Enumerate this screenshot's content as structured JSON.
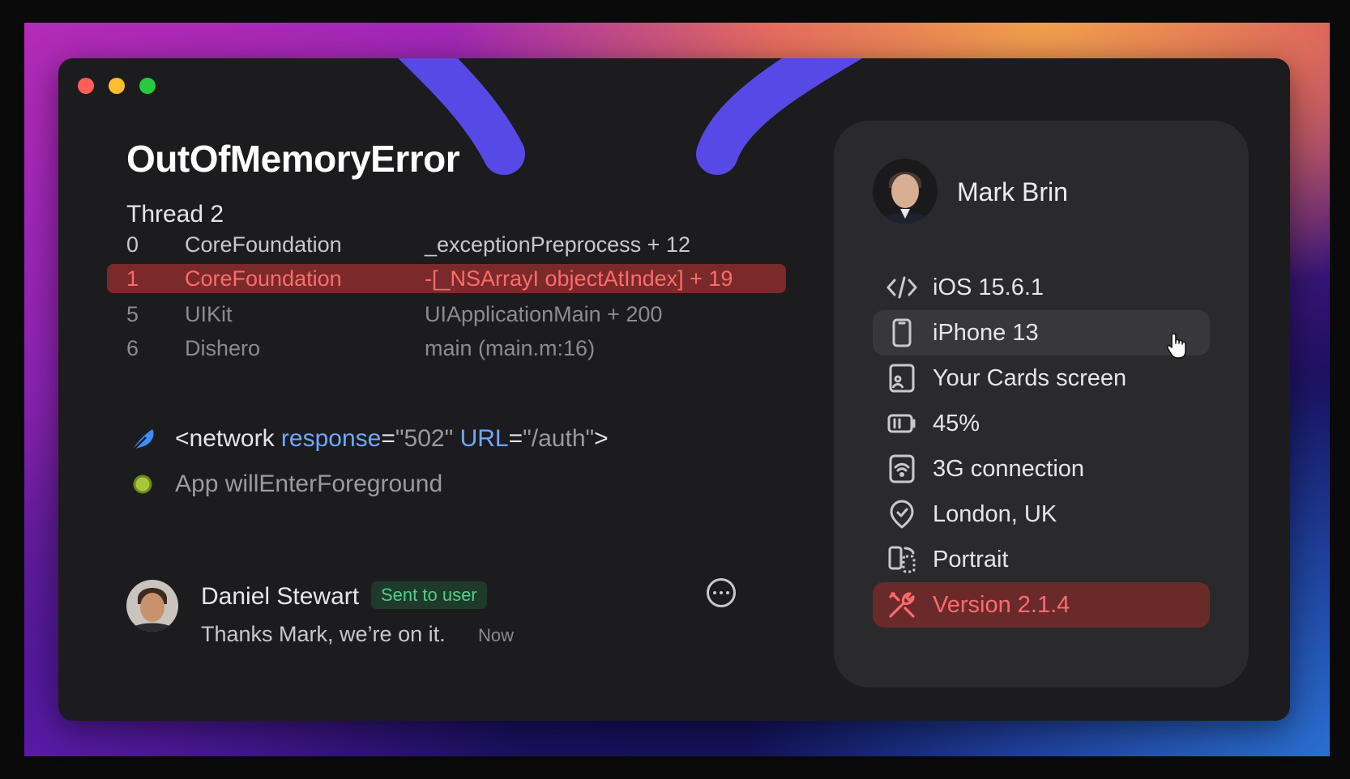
{
  "error": {
    "title": "OutOfMemoryError",
    "thread": "Thread 2",
    "stack": [
      {
        "index": "0",
        "library": "CoreFoundation",
        "function": "_exceptionPreprocess + 12",
        "state": "normal"
      },
      {
        "index": "1",
        "library": "CoreFoundation",
        "function": "-[_NSArrayI objectAtIndex] + 19",
        "state": "highlighted"
      },
      {
        "index": "5",
        "library": "UIKit",
        "function": "UIApplicationMain + 200",
        "state": "dim"
      },
      {
        "index": "6",
        "library": "Dishero",
        "function": "main (main.m:16)",
        "state": "dim"
      }
    ]
  },
  "events": {
    "network": {
      "tag_open": "<network",
      "attr1_name": "response",
      "attr1_value": "\"502\"",
      "attr2_name": "URL",
      "attr2_value": "\"/auth\"",
      "equals": "=",
      "tag_close": ">"
    },
    "lifecycle": "App willEnterForeground"
  },
  "comment": {
    "author": "Daniel Stewart",
    "badge": "Sent to user",
    "message": "Thanks Mark, we’re on it.",
    "time": "Now"
  },
  "user": {
    "name": "Mark Brin",
    "details": [
      {
        "icon": "code-icon",
        "label": "iOS 15.6.1",
        "state": "normal"
      },
      {
        "icon": "phone-icon",
        "label": "iPhone 13",
        "state": "hover"
      },
      {
        "icon": "screen-icon",
        "label": "Your Cards screen",
        "state": "normal"
      },
      {
        "icon": "battery-icon",
        "label": "45%",
        "state": "normal"
      },
      {
        "icon": "wifi-icon",
        "label": "3G connection",
        "state": "normal"
      },
      {
        "icon": "location-icon",
        "label": "London, UK",
        "state": "normal"
      },
      {
        "icon": "orientation-icon",
        "label": "Portrait",
        "state": "normal"
      },
      {
        "icon": "tools-icon",
        "label": "Version 2.1.4",
        "state": "alert"
      }
    ]
  },
  "colors": {
    "window_bg": "#1c1c1e",
    "panel_bg": "#2a2a2d",
    "alert_red": "#ff6b6b",
    "alert_bg": "#7a2a2a",
    "badge_green": "#4fd18a",
    "attr_blue": "#6fa8ff",
    "arc_purple": "#5b4cf0",
    "traffic_red": "#ff5f57",
    "traffic_yellow": "#febc2e",
    "traffic_green": "#28c840"
  }
}
